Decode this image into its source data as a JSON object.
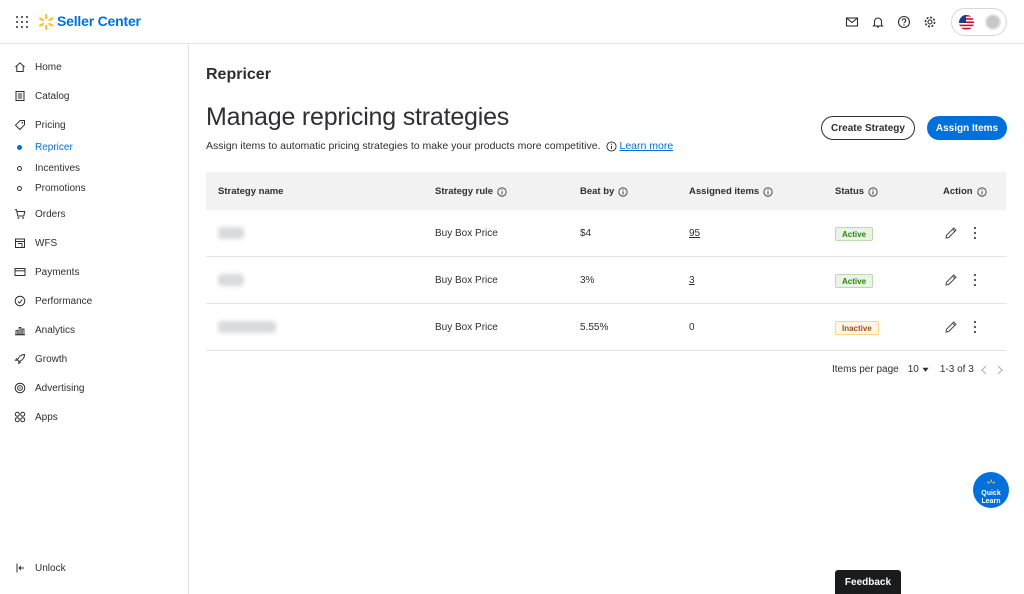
{
  "app": {
    "brand": "Seller Center"
  },
  "colors": {
    "accent": "#0071dc",
    "spark": "#ffc220",
    "active_badge": "#2a8703",
    "inactive_badge": "#995213"
  },
  "topbar": {
    "icons": [
      "mail-icon",
      "bell-icon",
      "help-icon",
      "gear-icon"
    ]
  },
  "sidebar": {
    "items": [
      {
        "label": "Home"
      },
      {
        "label": "Catalog"
      },
      {
        "label": "Pricing"
      },
      {
        "label": "Orders"
      },
      {
        "label": "WFS"
      },
      {
        "label": "Payments"
      },
      {
        "label": "Performance"
      },
      {
        "label": "Analytics"
      },
      {
        "label": "Growth"
      },
      {
        "label": "Advertising"
      },
      {
        "label": "Apps"
      }
    ],
    "pricing_sub": [
      {
        "label": "Repricer"
      },
      {
        "label": "Incentives"
      },
      {
        "label": "Promotions"
      }
    ],
    "unlock": "Unlock"
  },
  "main": {
    "page_title": "Repricer",
    "heading": "Manage repricing strategies",
    "subtext": "Assign items to automatic pricing strategies to make your products more competitive.",
    "learn_more": "Learn more",
    "create_button": "Create Strategy",
    "assign_button": "Assign Items"
  },
  "table": {
    "columns": [
      "Strategy name",
      "Strategy rule",
      "Beat by",
      "Assigned items",
      "Status",
      "Action"
    ],
    "rows": [
      {
        "rule": "Buy Box Price",
        "beat_by": "$4",
        "assigned": "95",
        "status": "Active"
      },
      {
        "rule": "Buy Box Price",
        "beat_by": "3%",
        "assigned": "3",
        "status": "Active"
      },
      {
        "rule": "Buy Box Price",
        "beat_by": "5.55%",
        "assigned": "0",
        "status": "Inactive"
      }
    ]
  },
  "pager": {
    "label": "Items per page",
    "per_page": "10",
    "range": "1-3 of 3"
  },
  "quick_learn": {
    "line1": "Quick",
    "line2": "Learn"
  },
  "feedback": "Feedback"
}
